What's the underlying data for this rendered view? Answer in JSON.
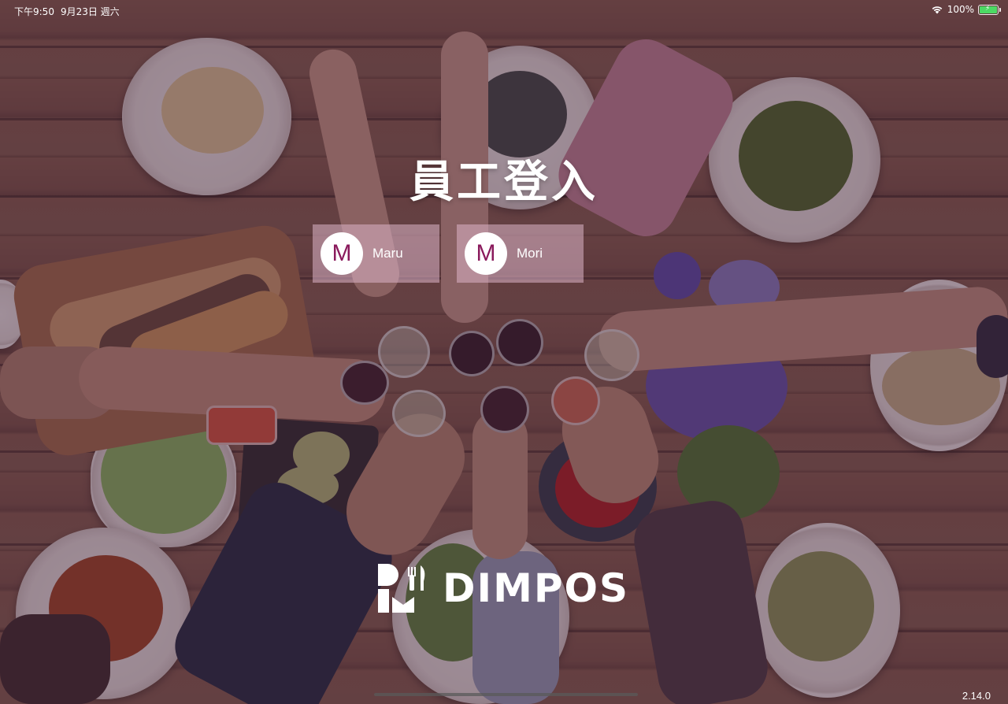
{
  "status_bar": {
    "time": "下午9:50",
    "date": "9月23日 週六",
    "battery_percent": "100%",
    "battery_level": 1.0
  },
  "page_title": "員工登入",
  "staff": [
    {
      "initial": "M",
      "name": "Maru"
    },
    {
      "initial": "M",
      "name": "Mori"
    }
  ],
  "logo": {
    "text": "DIMPOS"
  },
  "version": "2.14.0",
  "colors": {
    "overlay": "#3c1e37",
    "avatar_text": "#8a1a5c",
    "card_background": "#dcb4c8",
    "battery": "#4cd964"
  },
  "icons": {
    "wifi": "wifi-icon",
    "battery": "battery-icon",
    "logo": "dimpos-logo-icon"
  }
}
